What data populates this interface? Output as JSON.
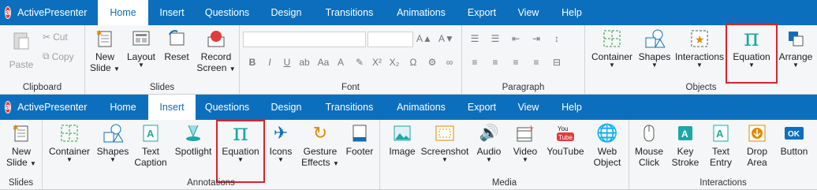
{
  "top": {
    "app_name": "ActivePresenter",
    "tabs": [
      "Home",
      "Insert",
      "Questions",
      "Design",
      "Transitions",
      "Animations",
      "Export",
      "View",
      "Help"
    ],
    "active": "Home",
    "groups": {
      "clipboard": "Clipboard",
      "slides": "Slides",
      "font": "Font",
      "paragraph": "Paragraph",
      "objects": "Objects"
    },
    "buttons": {
      "paste": "Paste",
      "cut": "Cut",
      "copy": "Copy",
      "new_slide": [
        "New",
        "Slide"
      ],
      "layout": "Layout",
      "reset": "Reset",
      "record_screen": [
        "Record",
        "Screen"
      ],
      "container": "Container",
      "shapes": "Shapes",
      "interactions": "Interactions",
      "equation": "Equation",
      "arrange": "Arrange"
    }
  },
  "bottom": {
    "app_name": "ActivePresenter",
    "tabs": [
      "Home",
      "Insert",
      "Questions",
      "Design",
      "Transitions",
      "Animations",
      "Export",
      "View",
      "Help"
    ],
    "active": "Insert",
    "groups": {
      "slides": "Slides",
      "annotations": "Annotations",
      "media": "Media",
      "interactions": "Interactions"
    },
    "buttons": {
      "new_slide": [
        "New",
        "Slide"
      ],
      "container": "Container",
      "shapes": "Shapes",
      "text_caption": [
        "Text",
        "Caption"
      ],
      "spotlight": "Spotlight",
      "equation": "Equation",
      "icons": "Icons",
      "gesture_effects": [
        "Gesture",
        "Effects"
      ],
      "footer": "Footer",
      "image": "Image",
      "screenshot": "Screenshot",
      "audio": "Audio",
      "video": "Video",
      "youtube": "YouTube",
      "web_object": [
        "Web",
        "Object"
      ],
      "mouse_click": [
        "Mouse",
        "Click"
      ],
      "key_stroke": [
        "Key",
        "Stroke"
      ],
      "text_entry": [
        "Text",
        "Entry"
      ],
      "drop_area": [
        "Drop",
        "Area"
      ],
      "button": "Button"
    }
  },
  "colors": {
    "titlebar": "#0b6fbd",
    "highlight": "#d9232d",
    "accent_teal": "#1ba7a7"
  }
}
